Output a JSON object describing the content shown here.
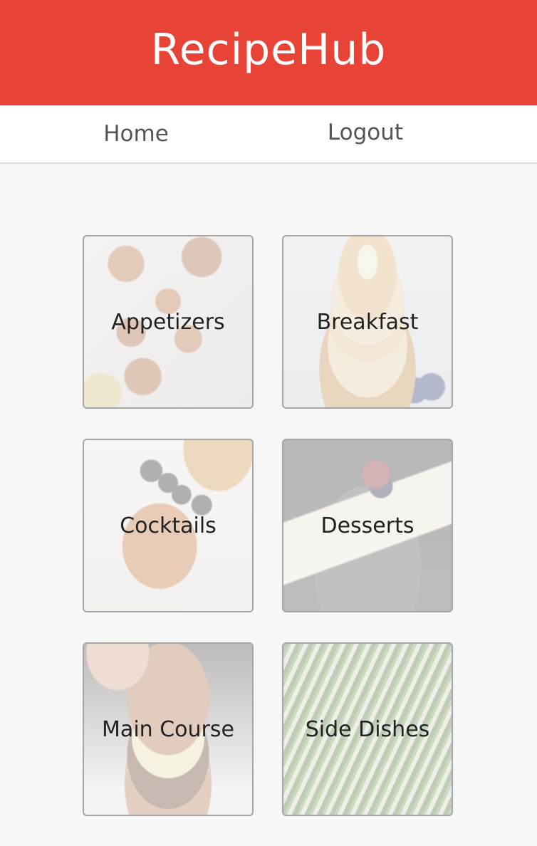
{
  "app": {
    "title": "RecipeHub"
  },
  "nav": {
    "home_label": "Home",
    "logout_label": "Logout"
  },
  "categories": [
    {
      "label": "Appetizers",
      "image": "appetizers-photo"
    },
    {
      "label": "Breakfast",
      "image": "pancakes-photo"
    },
    {
      "label": "Cocktails",
      "image": "cocktail-photo"
    },
    {
      "label": "Desserts",
      "image": "cheesecake-photo"
    },
    {
      "label": "Main Course",
      "image": "burger-photo"
    },
    {
      "label": "Side Dishes",
      "image": "green-beans-photo"
    }
  ],
  "colors": {
    "brand": "#e84337",
    "header_text": "#ffffff",
    "nav_text": "#555555",
    "card_border": "#a6a6a6",
    "background": "#f7f7f7"
  }
}
